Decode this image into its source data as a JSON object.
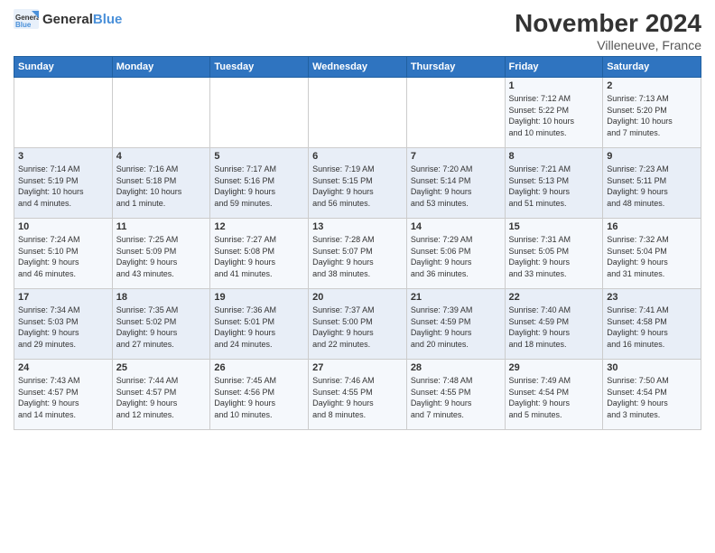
{
  "logo": {
    "general": "General",
    "blue": "Blue"
  },
  "header": {
    "title": "November 2024",
    "location": "Villeneuve, France"
  },
  "weekdays": [
    "Sunday",
    "Monday",
    "Tuesday",
    "Wednesday",
    "Thursday",
    "Friday",
    "Saturday"
  ],
  "weeks": [
    [
      {
        "day": "",
        "info": ""
      },
      {
        "day": "",
        "info": ""
      },
      {
        "day": "",
        "info": ""
      },
      {
        "day": "",
        "info": ""
      },
      {
        "day": "",
        "info": ""
      },
      {
        "day": "1",
        "info": "Sunrise: 7:12 AM\nSunset: 5:22 PM\nDaylight: 10 hours\nand 10 minutes."
      },
      {
        "day": "2",
        "info": "Sunrise: 7:13 AM\nSunset: 5:20 PM\nDaylight: 10 hours\nand 7 minutes."
      }
    ],
    [
      {
        "day": "3",
        "info": "Sunrise: 7:14 AM\nSunset: 5:19 PM\nDaylight: 10 hours\nand 4 minutes."
      },
      {
        "day": "4",
        "info": "Sunrise: 7:16 AM\nSunset: 5:18 PM\nDaylight: 10 hours\nand 1 minute."
      },
      {
        "day": "5",
        "info": "Sunrise: 7:17 AM\nSunset: 5:16 PM\nDaylight: 9 hours\nand 59 minutes."
      },
      {
        "day": "6",
        "info": "Sunrise: 7:19 AM\nSunset: 5:15 PM\nDaylight: 9 hours\nand 56 minutes."
      },
      {
        "day": "7",
        "info": "Sunrise: 7:20 AM\nSunset: 5:14 PM\nDaylight: 9 hours\nand 53 minutes."
      },
      {
        "day": "8",
        "info": "Sunrise: 7:21 AM\nSunset: 5:13 PM\nDaylight: 9 hours\nand 51 minutes."
      },
      {
        "day": "9",
        "info": "Sunrise: 7:23 AM\nSunset: 5:11 PM\nDaylight: 9 hours\nand 48 minutes."
      }
    ],
    [
      {
        "day": "10",
        "info": "Sunrise: 7:24 AM\nSunset: 5:10 PM\nDaylight: 9 hours\nand 46 minutes."
      },
      {
        "day": "11",
        "info": "Sunrise: 7:25 AM\nSunset: 5:09 PM\nDaylight: 9 hours\nand 43 minutes."
      },
      {
        "day": "12",
        "info": "Sunrise: 7:27 AM\nSunset: 5:08 PM\nDaylight: 9 hours\nand 41 minutes."
      },
      {
        "day": "13",
        "info": "Sunrise: 7:28 AM\nSunset: 5:07 PM\nDaylight: 9 hours\nand 38 minutes."
      },
      {
        "day": "14",
        "info": "Sunrise: 7:29 AM\nSunset: 5:06 PM\nDaylight: 9 hours\nand 36 minutes."
      },
      {
        "day": "15",
        "info": "Sunrise: 7:31 AM\nSunset: 5:05 PM\nDaylight: 9 hours\nand 33 minutes."
      },
      {
        "day": "16",
        "info": "Sunrise: 7:32 AM\nSunset: 5:04 PM\nDaylight: 9 hours\nand 31 minutes."
      }
    ],
    [
      {
        "day": "17",
        "info": "Sunrise: 7:34 AM\nSunset: 5:03 PM\nDaylight: 9 hours\nand 29 minutes."
      },
      {
        "day": "18",
        "info": "Sunrise: 7:35 AM\nSunset: 5:02 PM\nDaylight: 9 hours\nand 27 minutes."
      },
      {
        "day": "19",
        "info": "Sunrise: 7:36 AM\nSunset: 5:01 PM\nDaylight: 9 hours\nand 24 minutes."
      },
      {
        "day": "20",
        "info": "Sunrise: 7:37 AM\nSunset: 5:00 PM\nDaylight: 9 hours\nand 22 minutes."
      },
      {
        "day": "21",
        "info": "Sunrise: 7:39 AM\nSunset: 4:59 PM\nDaylight: 9 hours\nand 20 minutes."
      },
      {
        "day": "22",
        "info": "Sunrise: 7:40 AM\nSunset: 4:59 PM\nDaylight: 9 hours\nand 18 minutes."
      },
      {
        "day": "23",
        "info": "Sunrise: 7:41 AM\nSunset: 4:58 PM\nDaylight: 9 hours\nand 16 minutes."
      }
    ],
    [
      {
        "day": "24",
        "info": "Sunrise: 7:43 AM\nSunset: 4:57 PM\nDaylight: 9 hours\nand 14 minutes."
      },
      {
        "day": "25",
        "info": "Sunrise: 7:44 AM\nSunset: 4:57 PM\nDaylight: 9 hours\nand 12 minutes."
      },
      {
        "day": "26",
        "info": "Sunrise: 7:45 AM\nSunset: 4:56 PM\nDaylight: 9 hours\nand 10 minutes."
      },
      {
        "day": "27",
        "info": "Sunrise: 7:46 AM\nSunset: 4:55 PM\nDaylight: 9 hours\nand 8 minutes."
      },
      {
        "day": "28",
        "info": "Sunrise: 7:48 AM\nSunset: 4:55 PM\nDaylight: 9 hours\nand 7 minutes."
      },
      {
        "day": "29",
        "info": "Sunrise: 7:49 AM\nSunset: 4:54 PM\nDaylight: 9 hours\nand 5 minutes."
      },
      {
        "day": "30",
        "info": "Sunrise: 7:50 AM\nSunset: 4:54 PM\nDaylight: 9 hours\nand 3 minutes."
      }
    ]
  ]
}
